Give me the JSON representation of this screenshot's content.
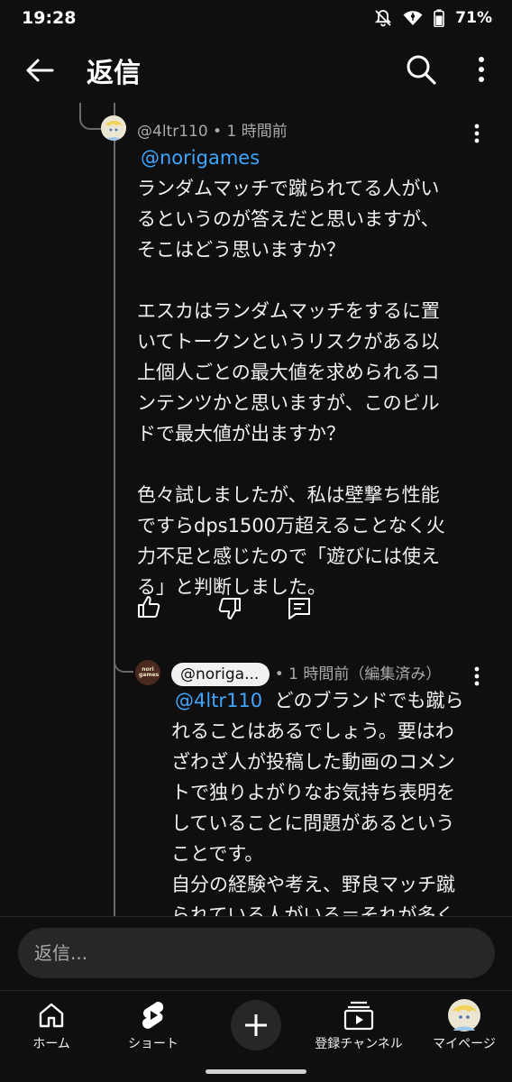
{
  "status": {
    "time": "19:28",
    "battery": "71%"
  },
  "header": {
    "title": "返信"
  },
  "comment": {
    "author": "@4ltr110",
    "time": "1 時間前",
    "mention": "@norigames",
    "paragraphs": [
      [
        "ランダムマッチで蹴られてる人がい",
        "るというのが答えだと思いますが、",
        "そこはどう思いますか？"
      ],
      [
        "エスカはランダムマッチをするに置",
        "いてトークンというリスクがある以",
        "上個人ごとの最大値を求められるコ",
        "ンテンツかと思いますが、このビル",
        "ドで最大値が出ますか？"
      ],
      [
        "色々試しましたが、私は壁撃ち性能",
        "ですらdps1500万超えることなく火",
        "力不足と感じたので「遊びには使え",
        "る」と判断しました。"
      ]
    ]
  },
  "reply": {
    "author": "@noriga...",
    "time": "1 時間前（編集済み）",
    "avatar_text": "nori games",
    "mention": "@4ltr110",
    "lines": [
      "どのブランドでも蹴ら",
      "れることはあるでしょう。要はわ",
      "ざわざ人が投稿した動画のコメン",
      "トで独りよがりなお気持ち表明を",
      "していることに問題があるという",
      "ことです。",
      "自分の経験や考え、野良マッチ蹴",
      "られている人がいる＝それが多く"
    ]
  },
  "reply_box": {
    "placeholder": "返信..."
  },
  "nav": {
    "home": "ホーム",
    "shorts": "ショート",
    "subscriptions": "登録チャンネル",
    "you": "マイページ"
  },
  "colors": {
    "background": "#0f0f0f",
    "link": "#3ea6ff",
    "secondary_text": "#aaaaaa"
  }
}
